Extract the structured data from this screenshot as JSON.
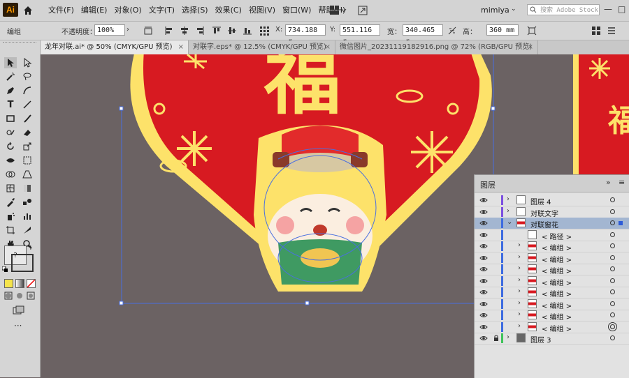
{
  "app": {
    "logo": "Ai",
    "user": "mimiya",
    "search_placeholder": "搜索 Adobe Stock"
  },
  "menu": [
    "文件(F)",
    "编辑(E)",
    "对象(O)",
    "文字(T)",
    "选择(S)",
    "效果(C)",
    "视图(V)",
    "窗口(W)",
    "帮助(H)"
  ],
  "control": {
    "selection": "编组",
    "opacity_label": "不透明度：",
    "opacity_value": "100%",
    "x_label": "X:",
    "x_value": "734.188 r",
    "y_label": "Y:",
    "y_value": "551.116 r",
    "w_label": "宽：",
    "w_value": "340.465 r",
    "h_label": "高：",
    "h_value": "360 mm"
  },
  "tabs": [
    {
      "label": "龙年对联.ai* @ 50% (CMYK/GPU 预览)",
      "close": "×"
    },
    {
      "label": "对联字.eps* @ 12.5% (CMYK/GPU 预览)",
      "close": "×"
    },
    {
      "label": "微信图片_20231119182916.png @ 72% (RGB/GPU 预览)",
      "close": "×"
    }
  ],
  "layers_panel": {
    "title": "图层",
    "collapse_icon": "»",
    "menu_icon": "≡",
    "rows": [
      {
        "name": "图层 4",
        "expand": "›",
        "color": "#7b4fe0"
      },
      {
        "name": "对联文字",
        "expand": "›",
        "color": "#7b4fe0"
      },
      {
        "name": "对联窗花",
        "expand": "⌄",
        "color": "#3d6be0"
      },
      {
        "name": "< 路径 >",
        "expand": "",
        "color": "#3d6be0"
      },
      {
        "name": "< 编组 >",
        "expand": "›",
        "color": "#3d6be0"
      },
      {
        "name": "< 编组 >",
        "expand": "›",
        "color": "#3d6be0"
      },
      {
        "name": "< 编组 >",
        "expand": "›",
        "color": "#3d6be0"
      },
      {
        "name": "< 编组 >",
        "expand": "›",
        "color": "#3d6be0"
      },
      {
        "name": "< 编组 >",
        "expand": "›",
        "color": "#3d6be0"
      },
      {
        "name": "< 编组 >",
        "expand": "›",
        "color": "#3d6be0"
      },
      {
        "name": "< 编组 >",
        "expand": "›",
        "color": "#3d6be0"
      },
      {
        "name": "< 编组 >",
        "expand": "›",
        "color": "#3d6be0"
      },
      {
        "name": "图层 3",
        "expand": "›",
        "color": "#3fc35a"
      }
    ]
  },
  "artwork": {
    "main_glyph": "福",
    "right_glyph": "福"
  },
  "colors": {
    "red": "#d71a21",
    "yellow": "#fde26a",
    "canvas": "#6b6263",
    "selection": "#4a6fe0"
  }
}
